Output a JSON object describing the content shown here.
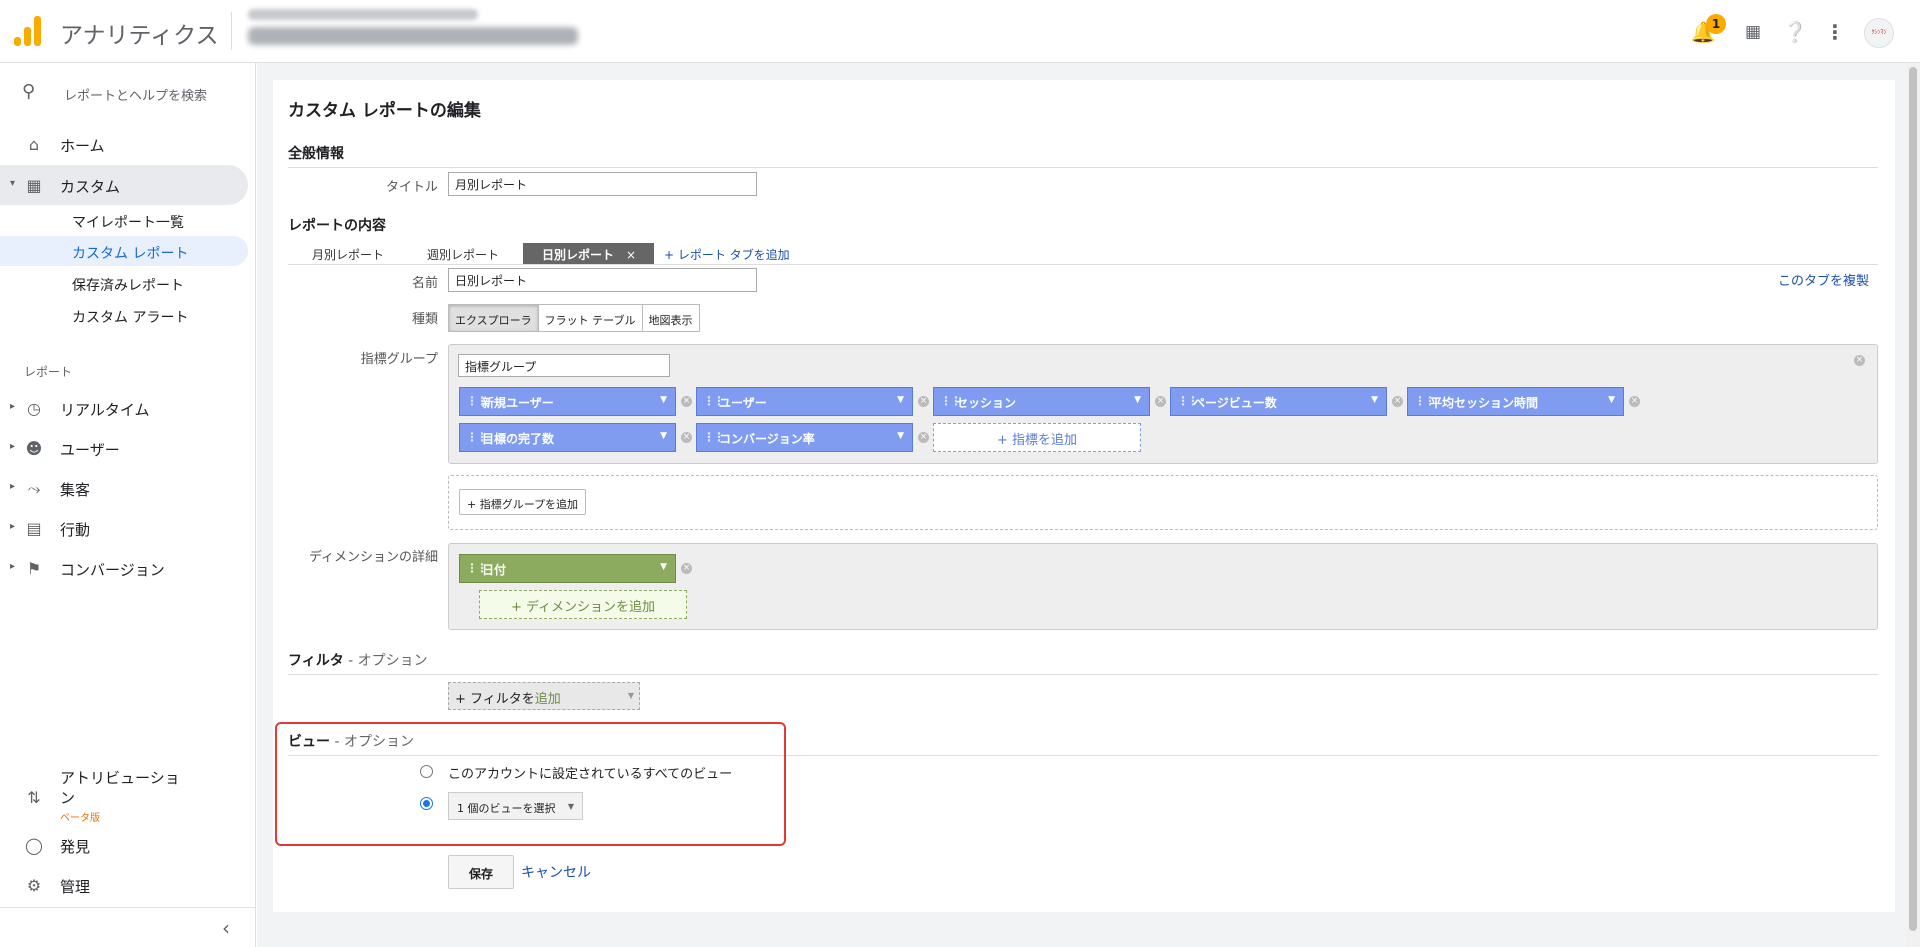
{
  "app": {
    "title": "アナリティクス",
    "notification_count": "1",
    "avatar_text": "ｸｼﾝﾏﾝ"
  },
  "sidebar": {
    "search_placeholder": "レポートとヘルプを検索",
    "home": "ホーム",
    "custom": "カスタム",
    "sub_items": [
      "マイレポート一覧",
      "カスタム レポート",
      "保存済みレポート",
      "カスタム アラート"
    ],
    "reports_section": "レポート",
    "reports": [
      "リアルタイム",
      "ユーザー",
      "集客",
      "行動",
      "コンバージョン"
    ],
    "attribution": "アトリビューショ\nン",
    "beta": "ベータ版",
    "discover": "発見",
    "admin": "管理"
  },
  "editor": {
    "page_title": "カスタム レポートの編集",
    "general_header": "全般情報",
    "title_label": "タイトル",
    "title_value": "月別レポート",
    "content_header": "レポートの内容",
    "tabs": [
      "月別レポート",
      "週別レポート",
      "日別レポート"
    ],
    "tab_close": "×",
    "add_tab": "+ レポート タブを追加",
    "duplicate_tab": "このタブを複製",
    "name_label": "名前",
    "name_value": "日別レポート",
    "type_label": "種類",
    "types": [
      "エクスプローラ",
      "フラット テーブル",
      "地図表示"
    ],
    "metric_group_label": "指標グループ",
    "metric_group_name": "指標グループ",
    "metrics": [
      "新規ユーザー",
      "ユーザー",
      "セッション",
      "ページビュー数",
      "平均セッション時間",
      "目標の完了数",
      "コンバージョン率"
    ],
    "add_metric": "+ 指標を追加",
    "add_metric_group": "+ 指標グループを追加",
    "dimension_label": "ディメンションの詳細",
    "dimensions": [
      "日付"
    ],
    "add_dimension": "+ ディメンションを追加",
    "filter_header": "フィルタ",
    "filter_optional": " - オプション",
    "add_filter_prefix": "+ フィルタを",
    "add_filter_suffix": "追加",
    "view_header": "ビュー",
    "view_optional": " - オプション",
    "view_all": "このアカウントに設定されているすべてのビュー",
    "view_select": "1 個のビューを選択",
    "save": "保存",
    "cancel": "キャンセル"
  }
}
